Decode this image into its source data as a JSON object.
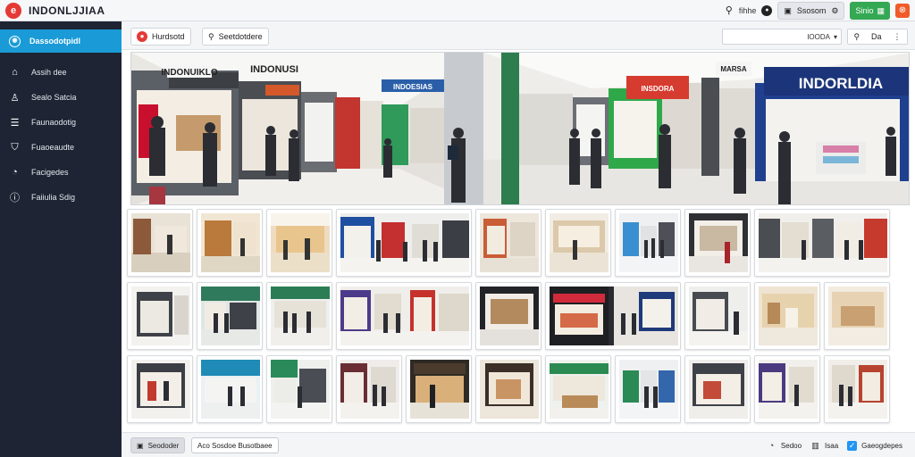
{
  "app": {
    "title": "INDONLJJIAA"
  },
  "topbar": {
    "user_label": "fihhe",
    "group_label": "Ssosom",
    "green_button_label": "Sinio",
    "colors": {
      "accent_green": "#34a853",
      "accent_red": "#e53935",
      "chip_orange": "#f05a28"
    },
    "icons": [
      "user-search-icon",
      "settings-icon",
      "monitor-icon",
      "gear-icon",
      "grid-icon",
      "close-icon"
    ]
  },
  "sidebar": {
    "active": {
      "label": "Dassodotpidl",
      "icon": "dashboard-icon"
    },
    "items": [
      {
        "label": "Assih dee",
        "icon": "home-icon"
      },
      {
        "label": "Sealo Satcia",
        "icon": "user-icon"
      },
      {
        "label": "Faunaodotig",
        "icon": "list-icon"
      },
      {
        "label": "Fuaoeaudte",
        "icon": "shield-icon"
      },
      {
        "label": "Facigedes",
        "icon": "gauge-icon"
      },
      {
        "label": "Faiiulia Sdig",
        "icon": "info-icon"
      }
    ],
    "colors": {
      "background": "#1e2433",
      "active": "#1a9bd7"
    }
  },
  "toolbar": {
    "primary_button": "Hurdsotd",
    "secondary_button": "Seetdotdere",
    "search_value": "IOODA",
    "search_suffix": "▾",
    "icons": [
      "search-icon",
      "chevron-down-icon",
      "image-icon"
    ],
    "icon_label": "Da"
  },
  "hero": {
    "left_store_sign": "INDONUIKLO",
    "left_banner": "INDONUSI",
    "left_center_sign": "INDOESIAS",
    "right_store_sign": "INDORLDIA",
    "right_banner": "MARSA",
    "right_red_sign": "INSDORA"
  },
  "bottombar": {
    "left_button": "Seododer",
    "right_button": "Aco Sosdoe Busotbaee",
    "links": [
      {
        "label": "Sedoo",
        "icon": "help-icon"
      },
      {
        "label": "Isaa",
        "icon": "chart-icon"
      },
      {
        "label": "Gaeogdepes",
        "icon": "verified-icon"
      }
    ]
  }
}
